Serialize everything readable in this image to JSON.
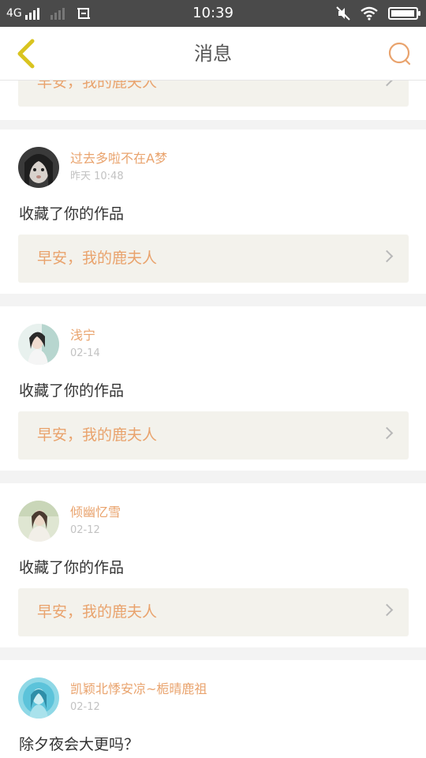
{
  "status_bar": {
    "network": "4G",
    "time": "10:39",
    "battery_level": 0.95,
    "icons": [
      "signal-icon",
      "signal-secondary-icon",
      "screenshot-icon",
      "mute-icon",
      "wifi-icon",
      "battery-icon"
    ]
  },
  "header": {
    "title": "消息",
    "back_icon": "chevron-left-icon",
    "search_icon": "search-icon"
  },
  "colors": {
    "accent": "#e9a36d",
    "back_icon": "#d9c420",
    "link_bg": "#f3f2ec",
    "page_bg": "#f3f3f3",
    "status_bar": "#4a4a4a"
  },
  "notifications": [
    {
      "username": "",
      "timestamp": "",
      "action": "",
      "work_title": "早安，我的鹿夫人"
    },
    {
      "username": "过去多啦不在A梦",
      "timestamp": "昨天 10:48",
      "action": "收藏了你的作品",
      "work_title": "早安，我的鹿夫人"
    },
    {
      "username": "浅宁",
      "timestamp": "02-14",
      "action": "收藏了你的作品",
      "work_title": "早安，我的鹿夫人"
    },
    {
      "username": "倾幽忆雪",
      "timestamp": "02-12",
      "action": "收藏了你的作品",
      "work_title": "早安，我的鹿夫人"
    },
    {
      "username": "凯颖北悸安凉~栀晴鹿祖",
      "timestamp": "02-12",
      "action": "除夕夜会大更吗？",
      "work_title": ""
    }
  ]
}
